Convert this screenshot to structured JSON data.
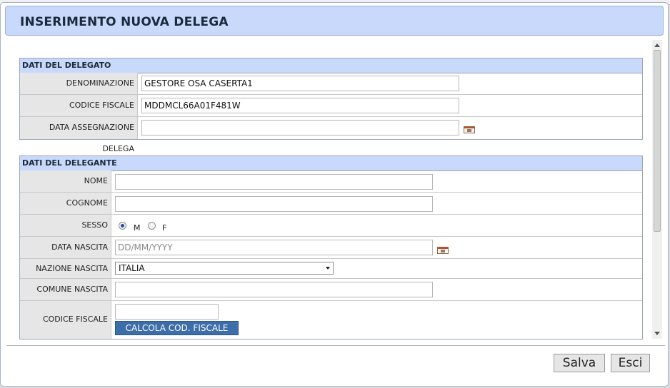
{
  "dialog": {
    "title": "INSERIMENTO NUOVA DELEGA"
  },
  "delegato": {
    "header": "DATI DEL DELEGATO",
    "denominazione": {
      "label": "DENOMINAZIONE",
      "value": "GESTORE OSA CASERTA1"
    },
    "codice_fiscale": {
      "label": "CODICE FISCALE",
      "value": "MDDMCL66A01F481W"
    },
    "data_assegnazione": {
      "label": "DATA ASSEGNAZIONE DELEGA",
      "value": ""
    }
  },
  "delegante": {
    "header": "DATI DEL DELEGANTE",
    "nome": {
      "label": "NOME",
      "value": ""
    },
    "cognome": {
      "label": "COGNOME",
      "value": ""
    },
    "sesso": {
      "label": "SESSO",
      "options": [
        "M",
        "F"
      ],
      "selected": "M"
    },
    "data_nascita": {
      "label": "DATA NASCITA",
      "value": "",
      "placeholder": "DD/MM/YYYY"
    },
    "nazione_nascita": {
      "label": "NAZIONE NASCITA",
      "selected": "ITALIA"
    },
    "comune_nascita": {
      "label": "COMUNE NASCITA",
      "value": ""
    },
    "codice_fiscale": {
      "label": "CODICE FISCALE",
      "value": "",
      "calc_button": "CALCOLA COD. FISCALE"
    }
  },
  "footer": {
    "save_label": "Salva",
    "exit_label": "Esci"
  },
  "colors": {
    "title_bar": "#c9d9fb",
    "panel_header": "#c9d9fb",
    "label_bg": "#e6e6e6",
    "calc_button": "#3d6ea9"
  },
  "icons": [
    "calendar-icon",
    "dropdown-arrow-icon"
  ]
}
